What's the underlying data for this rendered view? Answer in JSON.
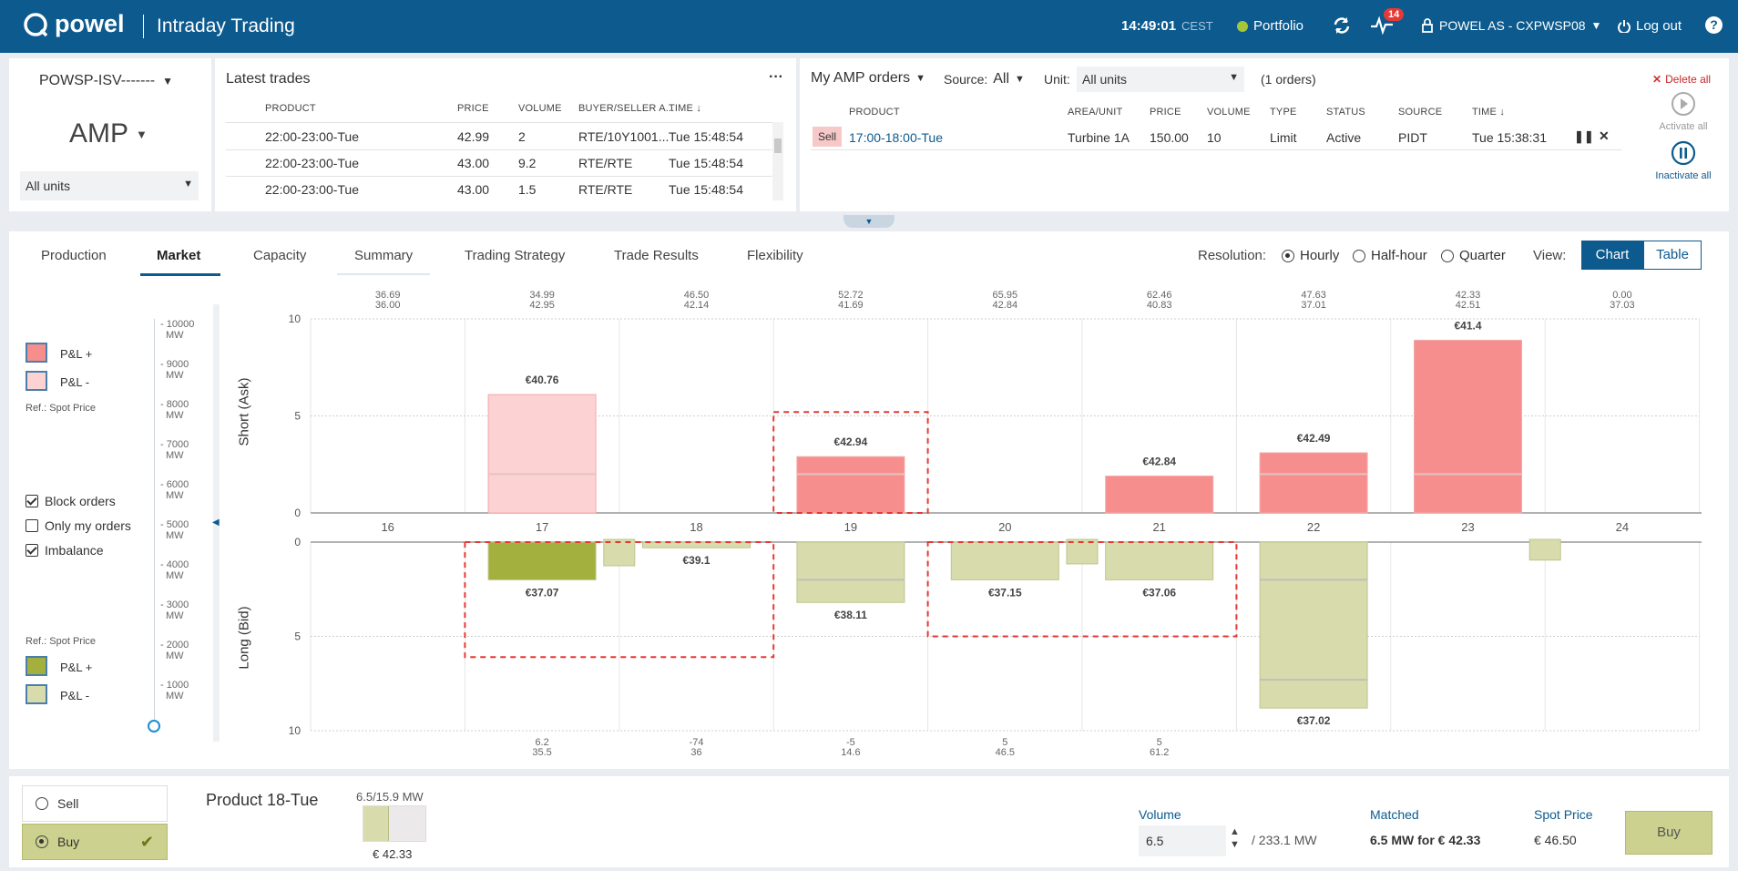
{
  "header": {
    "logo": "powel",
    "app_title": "Intraday Trading",
    "clock": "14:49:01",
    "timezone": "CEST",
    "portfolio_label": "Portfolio",
    "alerts_count": "14",
    "user": "POWEL AS - CXPWSP08",
    "logout_label": "Log out",
    "help": "?"
  },
  "left_panel": {
    "portfolio_select": "POWSP-ISV-------",
    "market_select": "AMP",
    "units_select": "All units"
  },
  "latest_trades": {
    "title": "Latest trades",
    "more": "···",
    "columns": [
      "PRODUCT",
      "PRICE",
      "VOLUME",
      "BUYER/SELLER A...",
      "TIME ↓"
    ],
    "rows": [
      [
        "22:00-23:00-Tue",
        "42.99",
        "2",
        "RTE/10Y1001...",
        "Tue 15:48:54"
      ],
      [
        "22:00-23:00-Tue",
        "43.00",
        "9.2",
        "RTE/RTE",
        "Tue 15:48:54"
      ],
      [
        "22:00-23:00-Tue",
        "43.00",
        "1.5",
        "RTE/RTE",
        "Tue 15:48:54"
      ]
    ]
  },
  "orders": {
    "title": "My AMP orders",
    "source_label": "Source:",
    "source_value": "All",
    "unit_label": "Unit:",
    "unit_value": "All units",
    "count": "(1 orders)",
    "delete_all": "Delete all",
    "activate_all": "Activate all",
    "inactivate_all": "Inactivate all",
    "columns": [
      "PRODUCT",
      "AREA/UNIT",
      "PRICE",
      "VOLUME",
      "TYPE",
      "STATUS",
      "SOURCE",
      "TIME ↓"
    ],
    "row": {
      "side": "Sell",
      "product": "17:00-18:00-Tue",
      "unit": "Turbine 1A",
      "price": "150.00",
      "volume": "10",
      "type": "Limit",
      "status": "Active",
      "source": "PIDT",
      "time": "Tue 15:38:31"
    }
  },
  "tabs": [
    "Production",
    "Market",
    "Capacity",
    "Summary",
    "Trading Strategy",
    "Trade Results",
    "Flexibility"
  ],
  "active_tab": "Market",
  "resolution": {
    "label": "Resolution:",
    "options": [
      "Hourly",
      "Half-hour",
      "Quarter"
    ],
    "selected": "Hourly"
  },
  "view": {
    "label": "View:",
    "options": [
      "Chart",
      "Table"
    ],
    "selected": "Chart"
  },
  "legend": {
    "pl_plus": "P&L +",
    "pl_minus": "P&L -",
    "ref_spot": "Ref.: Spot Price",
    "block_orders": "Block orders",
    "only_my_orders": "Only my orders",
    "imbalance": "Imbalance",
    "colors": {
      "ask_plus": "#f78e8e",
      "ask_minus": "#fdd2d2",
      "bid_plus": "#a3b03d",
      "bid_minus": "#d8dcac"
    }
  },
  "capacity_scale": [
    "10000 MW",
    "9000 MW",
    "8000 MW",
    "7000 MW",
    "6000 MW",
    "5000 MW",
    "4000 MW",
    "3000 MW",
    "2000 MW",
    "1000 MW"
  ],
  "chart_data": {
    "type": "bar",
    "categories": [
      "16",
      "17",
      "18",
      "19",
      "20",
      "21",
      "22",
      "23",
      "24"
    ],
    "top_price_pairs": [
      [
        "36.69",
        "36.00"
      ],
      [
        "34.99",
        "42.95"
      ],
      [
        "46.50",
        "42.14"
      ],
      [
        "52.72",
        "41.69"
      ],
      [
        "65.95",
        "42.84"
      ],
      [
        "62.46",
        "40.83"
      ],
      [
        "47.63",
        "37.01"
      ],
      [
        "42.33",
        "42.51"
      ],
      [
        "0.00",
        "37.03"
      ]
    ],
    "bottom_pairs": [
      [
        "",
        ""
      ],
      [
        "6.2",
        "35.5"
      ],
      [
        "-74",
        "36"
      ],
      [
        "-5",
        "14.6"
      ],
      [
        "5",
        "46.5"
      ],
      [
        "5",
        "61.2"
      ],
      [
        "",
        ""
      ],
      [
        "",
        ""
      ],
      [
        "",
        ""
      ]
    ],
    "upper_axis": {
      "label": "Short (Ask)",
      "ylim": [
        0,
        10
      ],
      "ticks": [
        "10",
        "5",
        "0"
      ]
    },
    "lower_axis": {
      "label": "Long (Bid)",
      "ylim": [
        0,
        10
      ],
      "ticks": [
        "0",
        "5",
        "10"
      ]
    },
    "ask": [
      0,
      6.1,
      0,
      2.9,
      0,
      1.9,
      3.1,
      8.9,
      0
    ],
    "ask_labels": [
      "",
      "€40.76",
      "",
      "€42.94",
      "",
      "€42.84",
      "€42.49",
      "€41.4",
      ""
    ],
    "ask_pl": [
      "",
      "minus",
      "",
      "plus",
      "",
      "plus",
      "plus",
      "plus",
      ""
    ],
    "bid": [
      0,
      2.0,
      0.3,
      3.2,
      2.0,
      2.0,
      8.8,
      0,
      0
    ],
    "bid_labels": [
      "",
      "€37.07",
      "€39.1",
      "€38.11",
      "€37.15",
      "€37.06",
      "€37.02",
      "",
      ""
    ],
    "bid_pl": [
      "",
      "plus",
      "minus",
      "minus",
      "minus",
      "minus",
      "minus",
      "",
      ""
    ],
    "imbalance": [
      0,
      1.4,
      0,
      0,
      1.3,
      0,
      0,
      1.1,
      0
    ],
    "block_orders": [
      {
        "from": 1,
        "to": 2,
        "bid": 6.1
      },
      {
        "from": 3,
        "to": 3,
        "ask": 5.2,
        "bid": 0
      },
      {
        "from": 4,
        "to": 5,
        "bid": 5.0
      }
    ]
  },
  "bottom": {
    "sell_label": "Sell",
    "buy_label": "Buy",
    "product_title": "Product 18-Tue",
    "ratio": "6.5/15.9 MW",
    "fill": 0.41,
    "product_price": "€ 42.33",
    "volume_label": "Volume",
    "volume_value": "6.5",
    "volume_max": "/ 233.1 MW",
    "matched_label": "Matched",
    "matched_value": "6.5 MW for € 42.33",
    "spot_label": "Spot Price",
    "spot_value": "€ 46.50",
    "buy_button": "Buy"
  }
}
